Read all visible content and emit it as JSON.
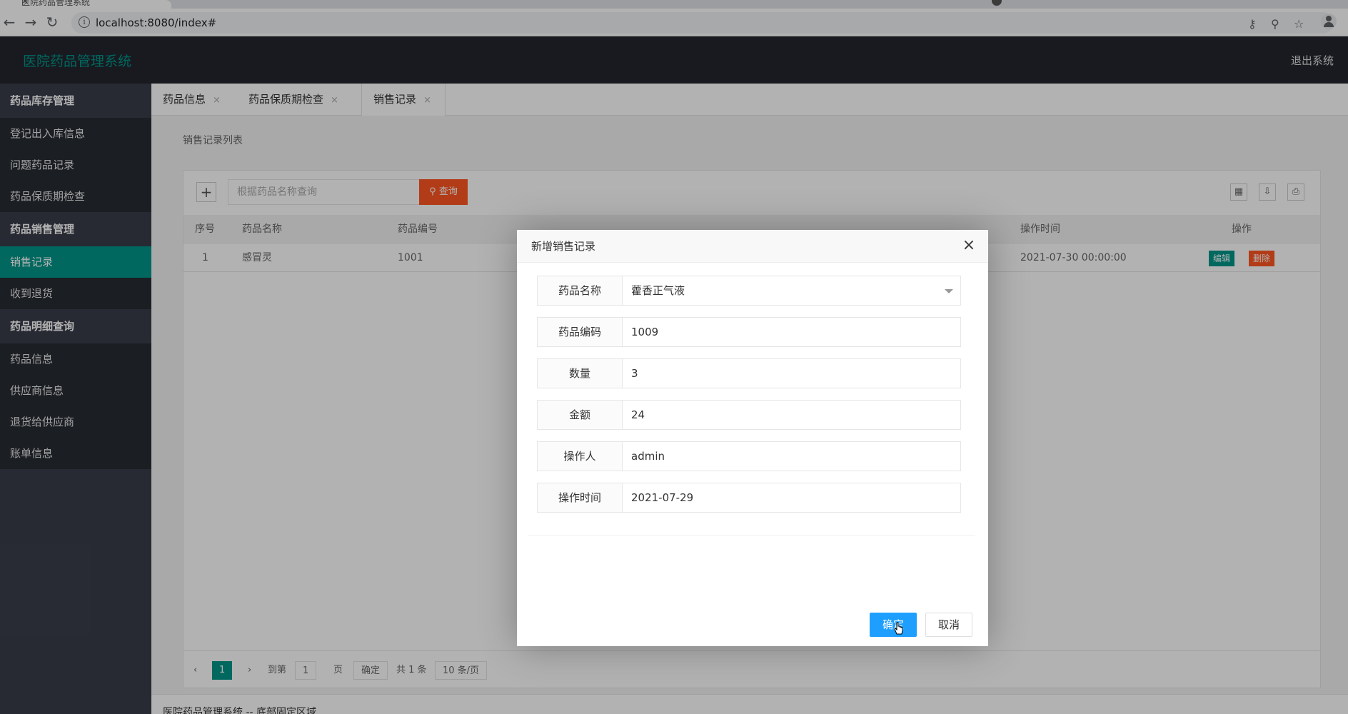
{
  "browser": {
    "tab_title": "医院药品管理系统",
    "tab_close": "×",
    "url": "localhost:8080/index#",
    "info_glyph": "i",
    "icons": [
      "back-arrow-icon",
      "forward-arrow-icon",
      "reload-icon",
      "key-icon",
      "zoom-icon",
      "star-icon",
      "account-icon"
    ]
  },
  "header": {
    "logo": "医院药品管理系统",
    "logout": "退出系统"
  },
  "sidebar": {
    "groups": [
      {
        "label": "药品库存管理",
        "items": [
          "登记出入库信息",
          "问题药品记录",
          "药品保质期检查"
        ]
      },
      {
        "label": "药品销售管理",
        "items": [
          "销售记录",
          "收到退货"
        ]
      },
      {
        "label": "药品明细查询",
        "items": [
          "药品信息",
          "供应商信息",
          "退货给供应商",
          "账单信息"
        ]
      }
    ],
    "active_item": "销售记录"
  },
  "tabs": [
    {
      "label": "药品信息",
      "close": "×"
    },
    {
      "label": "药品保质期检查",
      "close": "×"
    },
    {
      "label": "销售记录",
      "close": "×",
      "active": true
    }
  ],
  "content": {
    "panel_title": "销售记录列表",
    "add_glyph": "+",
    "search_placeholder": "根据药品名称查询",
    "search_button": "查询",
    "columns": [
      "序号",
      "药品名称",
      "药品编号",
      "操作时间",
      "操作"
    ],
    "rows": [
      {
        "index": "1",
        "name": "感冒灵",
        "code": "1001",
        "time": "2021-07-30 00:00:00",
        "edit": "编辑",
        "delete": "删除"
      }
    ],
    "pager": {
      "current_page": "1",
      "goto_label": "到第",
      "page_input": "1",
      "page_unit": "页",
      "confirm": "确定",
      "total": "共 1 条",
      "page_size": "10 条/页"
    }
  },
  "footer": {
    "text": "医院药品管理系统 -- 底部固定区域"
  },
  "dialog": {
    "title": "新增销售记录",
    "close": "×",
    "fields": [
      {
        "label": "药品名称",
        "value": "藿香正气液",
        "type": "select"
      },
      {
        "label": "药品编码",
        "value": "1009"
      },
      {
        "label": "数量",
        "value": "3"
      },
      {
        "label": "金额",
        "value": "24"
      },
      {
        "label": "操作人",
        "value": "admin"
      },
      {
        "label": "操作时间",
        "value": "2021-07-29"
      }
    ],
    "ok": "确定",
    "cancel": "取消"
  },
  "colors": {
    "accent": "#009688",
    "header_bg": "#23262e",
    "sidebar_bg": "#393d49",
    "primary_button": "#1e9fff",
    "danger": "#ff5722"
  }
}
